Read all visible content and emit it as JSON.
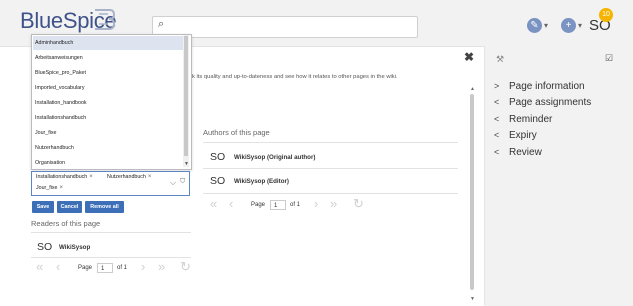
{
  "header": {
    "logo": "BlueSpice",
    "search_icon": "⌕",
    "edit_icon": "✎",
    "add_icon": "+",
    "caret": "▾",
    "user_initials": "SO",
    "notification_count": "10"
  },
  "dropdown": {
    "items": [
      "Adminhandbuch",
      "Arbeitsanweisungen",
      "BlueSpice_pro_Paket",
      "Imported_vocabulary",
      "Installation_handbook",
      "Installationshandbuch",
      "Jour_fixe",
      "Nutzerhandbuch",
      "Organisation"
    ],
    "highlighted": "Adminhandbuch"
  },
  "selected_tags": [
    "Installationshandbuch",
    "Nutzerhandbuch",
    "Jour_fixe"
  ],
  "tag_remove": "×",
  "buttons": {
    "save": "Save",
    "cancel": "Cancel",
    "remove_all": "Remove all"
  },
  "main": {
    "close": "✖",
    "info_text": "k its quality and up-to-dateness and see how it relates to other pages in the wiki.",
    "authors_title": "Authors of this page",
    "authors": [
      {
        "initials": "SO",
        "name": "WikiSysop (Original author)"
      },
      {
        "initials": "SO",
        "name": "WikiSysop (Editor)"
      }
    ],
    "readers_title": "Readers of this page",
    "readers": [
      {
        "initials": "SO",
        "name": "WikiSysop"
      }
    ],
    "pager": {
      "page_label": "Page",
      "page_value": "1",
      "of_label": "of 1"
    }
  },
  "sidebar": {
    "wrench_icon": "⚒",
    "checklist_icon": "☑",
    "items": [
      {
        "chevron": ">",
        "label": "Page information"
      },
      {
        "chevron": "<",
        "label": "Page assignments"
      },
      {
        "chevron": "<",
        "label": "Reminder"
      },
      {
        "chevron": "<",
        "label": "Expiry"
      },
      {
        "chevron": "<",
        "label": "Review"
      }
    ]
  }
}
